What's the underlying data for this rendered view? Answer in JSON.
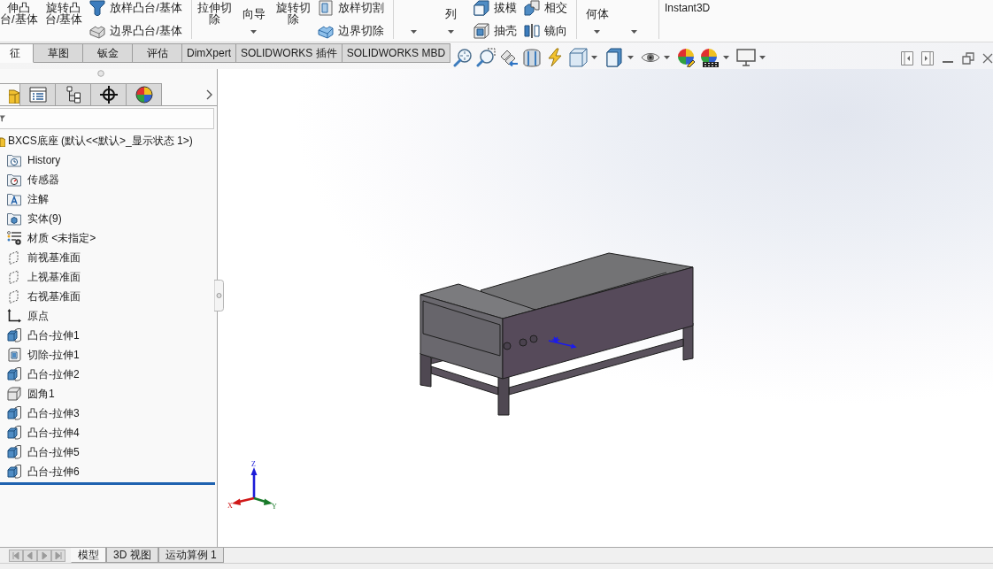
{
  "ribbon": {
    "groups": [
      {
        "items": [
          {
            "kind": "large",
            "lines": [
              "伸凸",
              "台/基体"
            ],
            "dropdown": false
          },
          {
            "kind": "large",
            "lines": [
              "旋转凸",
              "台/基体"
            ],
            "dropdown": false
          },
          {
            "kind": "stack",
            "buttons": [
              {
                "label": "放样凸台/基体"
              },
              {
                "label": "边界凸台/基体"
              }
            ]
          }
        ]
      },
      {
        "items": [
          {
            "kind": "large",
            "lines": [
              "拉伸切",
              "除"
            ],
            "dropdown": false
          },
          {
            "kind": "large",
            "lines": [
              "向导"
            ],
            "dropdown": true
          },
          {
            "kind": "large",
            "lines": [
              "旋转切",
              "除"
            ],
            "dropdown": false
          },
          {
            "kind": "stack",
            "buttons": [
              {
                "label": "放样切割"
              },
              {
                "label": "边界切除"
              }
            ]
          }
        ]
      },
      {
        "items": [
          {
            "kind": "large",
            "dropdown": true
          },
          {
            "kind": "large",
            "lines": [
              "列"
            ],
            "dropdown": true
          },
          {
            "kind": "stack",
            "buttons": [
              {
                "label": "拔模"
              },
              {
                "label": "抽壳"
              }
            ]
          },
          {
            "kind": "stack",
            "buttons": [
              {
                "label": "相交"
              },
              {
                "label": "镜向"
              }
            ]
          }
        ]
      },
      {
        "items": [
          {
            "kind": "large",
            "lines": [
              "何体"
            ],
            "dropdown": true
          },
          {
            "kind": "large",
            "dropdown": true
          }
        ]
      },
      {
        "items": [
          {
            "kind": "text",
            "label": "Instant3D"
          }
        ]
      }
    ]
  },
  "command_tabs": [
    {
      "label": "征",
      "selected": true
    },
    {
      "label": "草图",
      "selected": false
    },
    {
      "label": "钣金",
      "selected": false
    },
    {
      "label": "评估",
      "selected": false
    },
    {
      "label": "DimXpert",
      "selected": false
    },
    {
      "label": "SOLIDWORKS 插件",
      "selected": false
    },
    {
      "label": "SOLIDWORKS MBD",
      "selected": false
    }
  ],
  "panel_tabs": [
    {
      "selected": true
    },
    {
      "selected": false
    },
    {
      "selected": false
    },
    {
      "selected": false
    },
    {
      "selected": false
    }
  ],
  "feature_tree": {
    "root": {
      "label": "BXCS底座 (默认<<默认>_显示状态 1>)",
      "children": [
        {
          "kind": "history",
          "label": "History"
        },
        {
          "kind": "sensors",
          "label": "传感器"
        },
        {
          "kind": "annotations",
          "label": "注解"
        },
        {
          "kind": "bodies",
          "label": "实体(9)"
        },
        {
          "kind": "material",
          "label": "材质 <未指定>"
        },
        {
          "kind": "plane",
          "label": "前视基准面"
        },
        {
          "kind": "plane",
          "label": "上视基准面"
        },
        {
          "kind": "plane",
          "label": "右视基准面"
        },
        {
          "kind": "origin",
          "label": "原点"
        },
        {
          "kind": "boss",
          "label": "凸台-拉伸1"
        },
        {
          "kind": "cut",
          "label": "切除-拉伸1"
        },
        {
          "kind": "boss",
          "label": "凸台-拉伸2"
        },
        {
          "kind": "fillet",
          "label": "圆角1"
        },
        {
          "kind": "boss",
          "label": "凸台-拉伸3"
        },
        {
          "kind": "boss",
          "label": "凸台-拉伸4"
        },
        {
          "kind": "boss",
          "label": "凸台-拉伸5"
        },
        {
          "kind": "boss",
          "label": "凸台-拉伸6"
        }
      ]
    }
  },
  "triad": {
    "axes": [
      {
        "label": "Z",
        "color": "#1c1cd8"
      },
      {
        "label": "X",
        "color": "#d01818"
      },
      {
        "label": "Y",
        "color": "#1a7a2a"
      }
    ]
  },
  "bottom_tabs": [
    {
      "label": "模型",
      "selected": true
    },
    {
      "label": "3D 视图",
      "selected": false
    },
    {
      "label": "运动算例 1",
      "selected": false
    }
  ]
}
